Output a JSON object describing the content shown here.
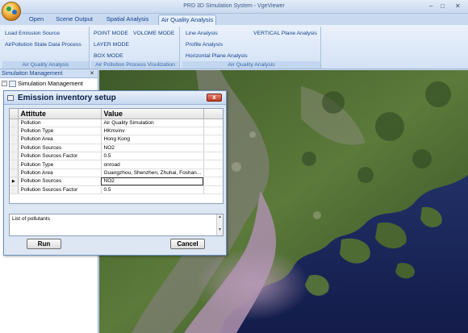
{
  "app": {
    "title": "PRD 3D Simulation System - VgeViewer",
    "window_controls": {
      "minimize": "–",
      "maximize": "□",
      "close": "✕"
    }
  },
  "tabs": [
    {
      "label": "Open"
    },
    {
      "label": "Scene Output"
    },
    {
      "label": "Spatial Analysis"
    },
    {
      "label": "Air Quality Analysis"
    }
  ],
  "ribbon": {
    "groups": [
      {
        "label": "Air Quality Analysis",
        "items": [
          "Load Emission Source",
          "AirPollution State Data Process"
        ]
      },
      {
        "label": "Air Pollution Process Visulization",
        "items": [
          "POINT  MODE",
          "VOLOME  MODE",
          "LAYER  MODE",
          "BOX  MODE"
        ]
      },
      {
        "label": "Air Quality Analysis",
        "items": [
          "Line Analysis",
          "VERTICAL Plane  Analysis",
          "Profile Analysis",
          "Horizontal Plane Analysis"
        ]
      }
    ]
  },
  "left_panel": {
    "header": "Simulaiton Management",
    "close": "✕",
    "tree_toggle": "−",
    "tree_root": "Simulation Management"
  },
  "dialog": {
    "title": "Emission inventory setup",
    "close": "x",
    "columns": [
      "Attitute",
      "Value"
    ],
    "current_row_marker": "▶",
    "rows": [
      {
        "attr": "Pollution",
        "value": "Air Quality Simulation"
      },
      {
        "attr": "Pollution Type",
        "value": "HKmvinv"
      },
      {
        "attr": "Pollution Area",
        "value": "Hong Kong"
      },
      {
        "attr": "Pollution Sources",
        "value": "NO2"
      },
      {
        "attr": "Pollution Sources Factor",
        "value": "0.5"
      },
      {
        "attr": "Pollution Type",
        "value": "onroad"
      },
      {
        "attr": "Pollution Area",
        "value": "Guangzhou, Shenzhen, Zhuhai, Foshan..."
      },
      {
        "attr": "Pollution Sources",
        "value": "NO2"
      },
      {
        "attr": "Pollution Sources Factor",
        "value": "0.5"
      }
    ],
    "description": "List of pollutants",
    "scroll_up": "▲",
    "scroll_down": "▼",
    "run_label": "Run",
    "cancel_label": "Cancel"
  },
  "colors": {
    "ribbon_text": "#15428b",
    "close_button": "#c03a22",
    "sea": "#1e2b5c",
    "land": "#4a6b32"
  },
  "map": {
    "kind": "satellite imagery"
  }
}
